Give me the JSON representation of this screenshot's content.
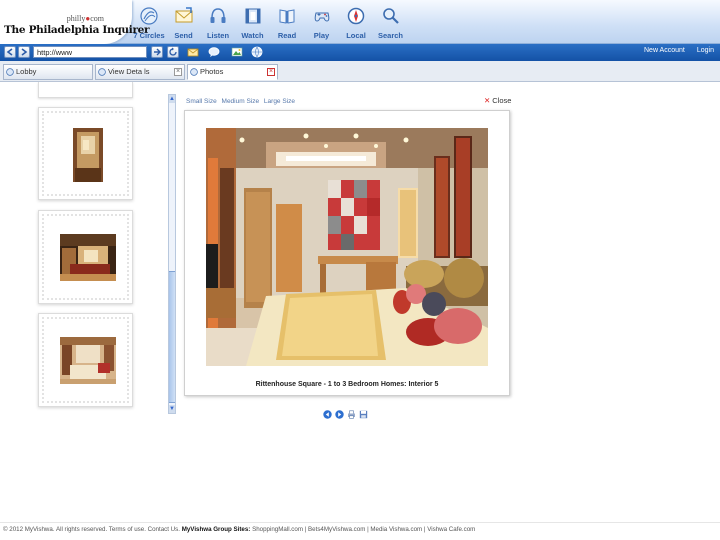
{
  "header": {
    "logo_philly": "philly",
    "logo_philly_dot": "com",
    "logo_name": "The Philadelphia Inquirer",
    "nav": [
      {
        "label": "7 Circles",
        "icon": "circles-icon"
      },
      {
        "label": "Send",
        "icon": "envelope-icon"
      },
      {
        "label": "Listen",
        "icon": "headphones-icon"
      },
      {
        "label": "Watch",
        "icon": "film-icon"
      },
      {
        "label": "Read",
        "icon": "book-icon"
      },
      {
        "label": "Play",
        "icon": "gamepad-icon"
      },
      {
        "label": "Local",
        "icon": "compass-icon"
      },
      {
        "label": "Search",
        "icon": "magnifier-icon"
      }
    ]
  },
  "toolbar": {
    "address_value": "http://www",
    "new_account": "New Account",
    "login": "Login"
  },
  "tabs": [
    {
      "label": "Lobby"
    },
    {
      "label": "View Deta ls"
    },
    {
      "label": "Photos"
    }
  ],
  "viewer": {
    "sizes": [
      "Small Size",
      "Medium Size",
      "Large Size"
    ],
    "close_label": "Close",
    "caption": "Rittenhouse Square - 1 to 3 Bedroom Homes: Interior 5"
  },
  "footer": {
    "copyright": "© 2012 MyVishwa. All rights reserved. Terms of use. Contact Us.",
    "group_label": "MyVishwa Group Sites:",
    "sites": "ShoppingMall.com | Bets4MyVishwa.com | Media Vishwa.com | Vishwa Cafe.com"
  },
  "colors": {
    "toolbar": "#1a5bb0",
    "nav_text": "#2d5fa8",
    "close_x": "#dd2222"
  }
}
